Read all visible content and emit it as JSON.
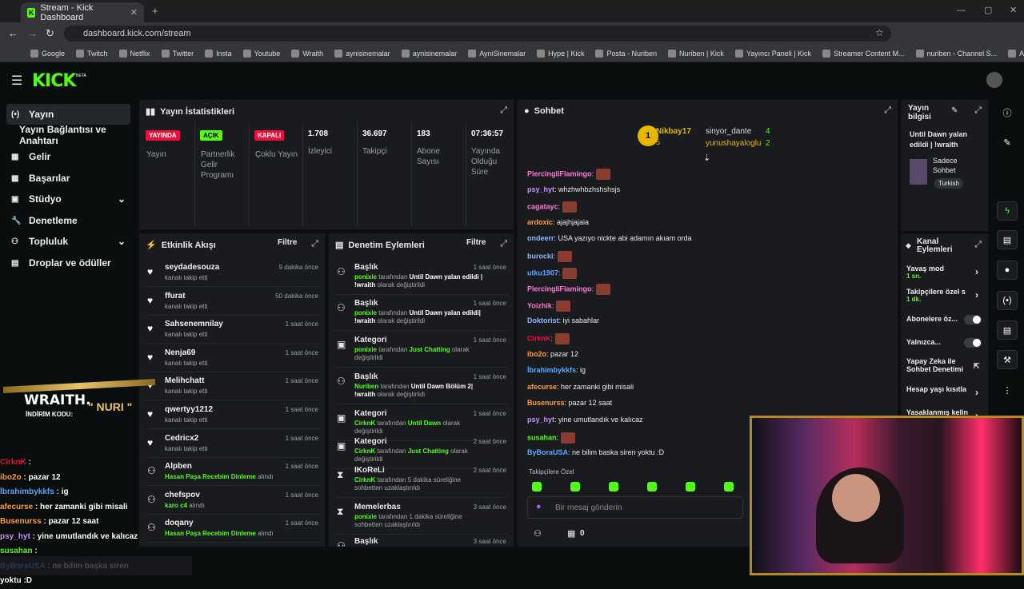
{
  "browser": {
    "tab_title": "Stream - Kick Dashboard",
    "url": "dashboard.kick.com/stream",
    "bookmarks": [
      "Google",
      "Twitch",
      "Netflix",
      "Twitter",
      "Insta",
      "Youtube",
      "Wraith",
      "aynisinemalar",
      "aynisinemalar",
      "AyniSinemalar",
      "Hype | Kick",
      "Posta - Nuriben",
      "Nuriben | Kick",
      "Yayıncı Paneli | Kick",
      "Streamer Content M...",
      "nuriben - Channel S...",
      "Aynı Sinemalar - Ça..."
    ]
  },
  "app": {
    "logo": "KICK",
    "beta": "BETA"
  },
  "sidebar": {
    "items": [
      {
        "label": "Yayın",
        "icon": "broadcast-icon"
      },
      {
        "label": "Yayın Bağlantısı ve Anahtarı",
        "icon": ""
      },
      {
        "label": "Gelir",
        "icon": "revenue-icon"
      },
      {
        "label": "Başarılar",
        "icon": "achievements-icon"
      },
      {
        "label": "Stüdyo",
        "icon": "studio-icon"
      },
      {
        "label": "Denetleme",
        "icon": "moderation-icon"
      },
      {
        "label": "Topluluk",
        "icon": "community-icon"
      },
      {
        "label": "Droplar ve ödüller",
        "icon": "drops-icon"
      }
    ]
  },
  "stats": {
    "title": "Yayın İstatistikleri",
    "cells": [
      {
        "badge": "YAYINDA",
        "badge_color": "#e9113c",
        "label": "Yayın"
      },
      {
        "badge": "AÇIK",
        "badge_color": "#53fc18",
        "label": "Partnerlik Gelir Programı"
      },
      {
        "badge": "KAPALI",
        "badge_color": "#e9113c",
        "label": "Çoklu Yayın"
      },
      {
        "value": "1.708",
        "label": "İzleyici"
      },
      {
        "value": "36.697",
        "label": "Takipçi"
      },
      {
        "value": "183",
        "label": "Abone Sayısı"
      },
      {
        "value": "07:36:57",
        "label": "Yayında Olduğu Süre"
      }
    ]
  },
  "activity": {
    "title": "Etkinlik Akışı",
    "filter": "Filtre",
    "items": [
      {
        "name": "seydadesouza",
        "sub": "kanalı takip etti",
        "time": "9 dakika önce"
      },
      {
        "name": "ffurat",
        "sub": "kanalı takip etti",
        "time": "50 dakika önce"
      },
      {
        "name": "Sahsenemnilay",
        "sub": "kanalı takip etti",
        "time": "1 saat önce"
      },
      {
        "name": "Nenja69",
        "sub": "kanalı takip etti",
        "time": "1 saat önce"
      },
      {
        "name": "Melihchatt",
        "sub": "kanalı takip etti",
        "time": "1 saat önce"
      },
      {
        "name": "qwertyy1212",
        "sub": "kanalı takip etti",
        "time": "1 saat önce"
      },
      {
        "name": "Cedricx2",
        "sub": "kanalı takip etti",
        "time": "1 saat önce"
      },
      {
        "name": "Alpben",
        "sub_green": "Hasan Paşa Recebim Dinleme",
        "sub": "alındı",
        "time": "1 saat önce"
      },
      {
        "name": "chefspov",
        "sub_green": "karo c4",
        "sub": "alındı",
        "time": "1 saat önce"
      },
      {
        "name": "doqany",
        "sub_green": "Hasan Paşa Recebim Dinleme",
        "sub": "alındı",
        "time": "1 saat önce"
      }
    ]
  },
  "moderation": {
    "title": "Denetim Eylemleri",
    "filter": "Filtre",
    "items": [
      {
        "title": "Başlık",
        "time": "1 saat önce",
        "user": "ponixie",
        "by": "tarafından",
        "val": "Until Dawn yalan edildi | !wraith",
        "tail": "olarak değiştirildi"
      },
      {
        "title": "Başlık",
        "time": "1 saat önce",
        "user": "ponixie",
        "by": "tarafından",
        "val": "Until Dawn yalan edildi| !wraith",
        "tail": "olarak değiştirildi"
      },
      {
        "title": "Kategori",
        "time": "1 saat önce",
        "user": "ponixie",
        "by": "tarafından",
        "val": "Just Chatting",
        "tail": "olarak değiştirildi"
      },
      {
        "title": "Başlık",
        "time": "1 saat önce",
        "user": "Nuriben",
        "by": "tarafından",
        "val": "Until Dawn Bölüm 2| !wraith",
        "tail": "olarak değiştirildi"
      },
      {
        "title": "Kategori",
        "time": "1 saat önce",
        "user": "CirknK",
        "by": "tarafından",
        "val": "Until Dawn",
        "tail": "olarak değiştirildi"
      },
      {
        "title": "Kategori",
        "time": "2 saat önce",
        "user": "CirknK",
        "by": "tarafından",
        "val": "Just Chatting",
        "tail": "olarak değiştirildi"
      },
      {
        "title": "IKoReLi",
        "time": "2 saat önce",
        "user": "CirknK",
        "by": "tarafından 5 dakika süreliğine sohbetten uzaklaştırıldı",
        "val": "",
        "tail": ""
      },
      {
        "title": "Memelerbas",
        "time": "3 saat önce",
        "user": "ponixie",
        "by": "tarafından 1 dakika süreliğine sohbetten uzaklaştırıldı",
        "val": "",
        "tail": ""
      },
      {
        "title": "Başlık",
        "time": "3 saat önce",
        "user": "",
        "by": "",
        "val": "",
        "tail": ""
      }
    ]
  },
  "chat": {
    "title": "Sohbet",
    "top": [
      {
        "rank": "1",
        "name": "Nikbay17",
        "count": "5"
      },
      {
        "name": "sinyor_dante",
        "count": "4"
      },
      {
        "name": "yunushayaloglu",
        "count": "2"
      }
    ],
    "messages": [
      {
        "user": "PiercingliFlamingo",
        "color": "#ff7ad9",
        "text": ""
      },
      {
        "user": "psy_hyt",
        "color": "#c792ff",
        "text": "whzhwhbzhshshsjs"
      },
      {
        "user": "cagatayc",
        "color": "#ff7ad9",
        "text": ""
      },
      {
        "user": "ardoxic",
        "color": "#ff9e3d",
        "text": "ajajhjajaia"
      },
      {
        "user": "ondeerr",
        "color": "#8fb8ff",
        "text": "USA yazıyo nickte abi adamın akıam orda"
      },
      {
        "user": "burocki",
        "color": "#8fb8ff",
        "text": ""
      },
      {
        "user": "utku1907",
        "color": "#5aa8ff",
        "text": ""
      },
      {
        "user": "PiercingliFlamingo",
        "color": "#ff7ad9",
        "text": ""
      },
      {
        "user": "Yoizhik",
        "color": "#ff7ad9",
        "text": ""
      },
      {
        "user": "Doktorist",
        "color": "#8fb8ff",
        "text": "iyi sabahlar"
      },
      {
        "user": "CirknK",
        "color": "#e9113c",
        "text": ""
      },
      {
        "user": "ibo2o",
        "color": "#ff9e3d",
        "text": "pazar 12"
      },
      {
        "user": "İbrahimbykkfs",
        "color": "#5aa8ff",
        "text": "ig"
      },
      {
        "user": "afecurse",
        "color": "#ff9e3d",
        "text": "her zamanki gibi misali"
      },
      {
        "user": "Busenurss",
        "color": "#ff9e3d",
        "text": "pazar 12 saat"
      },
      {
        "user": "psy_hyt",
        "color": "#c792ff",
        "text": "yine umutlandık ve kalıcaz"
      },
      {
        "user": "susahan",
        "color": "#53fc18",
        "text": ""
      },
      {
        "user": "ByBoraUSA",
        "color": "#5aa8ff",
        "text": "ne bilim baska siren yoktu :D"
      }
    ],
    "followers_only": "Takipçilere Özel",
    "input_placeholder": "Bir mesaj gönderin",
    "counter": "0"
  },
  "stream_info": {
    "title": "Yayın bilgisi",
    "stream_title": "Until Dawn yalan edildi | !wraith",
    "mode": "Sadece Sohbet",
    "language": "Turkish"
  },
  "channel_actions": {
    "title": "Kanal Eylemleri",
    "items": [
      {
        "label": "Yavaş mod",
        "sub": "1 sn."
      },
      {
        "label": "Takipçilere özel s",
        "sub": "1 dk."
      },
      {
        "label": "Abonelere öz...",
        "sub": ""
      },
      {
        "label": "Yalnızca...",
        "sub": ""
      },
      {
        "label": "Yapay Zeka ile Sohbet Denetimi",
        "sub": ""
      },
      {
        "label": "Hesap yaşı kısıtla",
        "sub": ""
      },
      {
        "label": "Yasaklanmış kelin",
        "sub": ""
      }
    ]
  },
  "overlay": {
    "brand": "WRAITH.",
    "promo_label": "İNDİRİM KODU:",
    "promo_code": "\" NURI \"",
    "lines": [
      {
        "user": "CirknK",
        "text": "",
        "color": "#e9113c"
      },
      {
        "user": "ibo2o",
        "text": "pazar 12",
        "color": "#ff9e3d"
      },
      {
        "user": "İbrahimbykkfs",
        "text": "ig",
        "color": "#5aa8ff"
      },
      {
        "user": "afecurse",
        "text": "her zamanki gibi misali",
        "color": "#ff9e3d"
      },
      {
        "user": "Busenurss",
        "text": "pazar 12 saat",
        "color": "#ff9e3d"
      },
      {
        "user": "psy_hyt",
        "text": "yine umutlandık ve kalıcaz",
        "color": "#c792ff"
      },
      {
        "user": "susahan",
        "text": "",
        "color": "#53fc18"
      },
      {
        "user": "ByBoraUSA",
        "text": "ne bilim başka siren yoktu :D",
        "color": "#5aa8ff"
      }
    ]
  }
}
